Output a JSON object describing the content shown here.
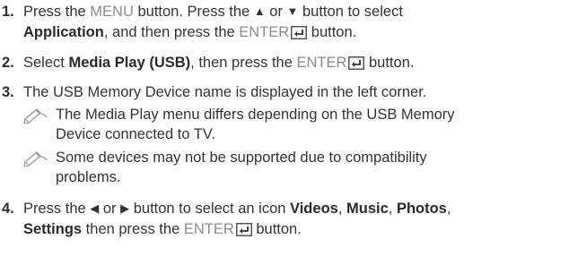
{
  "steps": [
    {
      "number": "1.",
      "lines": [
        [
          "Press the ",
          "MENU",
          " button. Press the ",
          "▲",
          " or ",
          "▼",
          " button to select"
        ],
        [
          "Application",
          ", and then press the ",
          "ENTER",
          " button."
        ]
      ]
    },
    {
      "number": "2.",
      "lines": [
        [
          "Select ",
          "Media Play (USB)",
          ", then press the ",
          "ENTER",
          " button."
        ]
      ]
    },
    {
      "number": "3.",
      "lines": [
        [
          "The USB Memory Device name is displayed in the left corner."
        ]
      ],
      "notes": [
        {
          "icon": "pencil-note-icon",
          "lines": [
            "The Media Play menu differs depending on the USB Memory",
            "Device connected to TV."
          ]
        },
        {
          "icon": "pencil-note-icon",
          "lines": [
            "Some devices may not be supported due to compatibility",
            "problems."
          ]
        }
      ]
    },
    {
      "number": "4.",
      "lines": [
        [
          "Press the ",
          "◀",
          " or ",
          "▶",
          " button to select an icon ",
          "Videos",
          ", ",
          "Music",
          ", ",
          "Photos",
          ","
        ],
        [
          "Settings",
          " then press the ",
          "ENTER",
          " button."
        ]
      ]
    }
  ]
}
